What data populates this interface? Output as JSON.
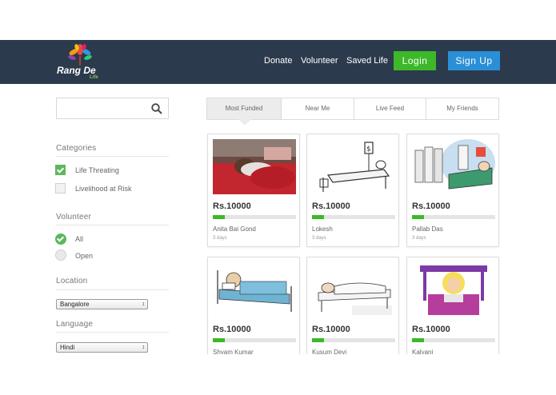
{
  "brand": {
    "name": "Rang De",
    "sub": "Life"
  },
  "nav": {
    "links": [
      "Donate",
      "Volunteer",
      "Saved Life"
    ],
    "login": "Login",
    "signup": "Sign Up"
  },
  "search": {
    "placeholder": ""
  },
  "filters": {
    "categories_title": "Categories",
    "categories": [
      {
        "label": "Life Threating",
        "checked": true
      },
      {
        "label": "Livelihood at Risk",
        "checked": false
      }
    ],
    "volunteer_title": "Volunteer",
    "volunteer": [
      {
        "label": "All",
        "selected": true
      },
      {
        "label": "Open",
        "selected": false
      }
    ],
    "location_title": "Location",
    "location_value": "Bangalore",
    "language_title": "Language",
    "language_value": "Hindi"
  },
  "tabs": [
    "Most Funded",
    "Near Me",
    "Live Feed",
    "My Friends"
  ],
  "cards": [
    {
      "amount": "Rs.10000",
      "name": "Anita Bai Gond",
      "days": "3 days",
      "progress": 0.14
    },
    {
      "amount": "Rs.10000",
      "name": "Lokesh",
      "days": "3 days",
      "progress": 0.14
    },
    {
      "amount": "Rs.10000",
      "name": "Pallab Das",
      "days": "3 days",
      "progress": 0.14
    },
    {
      "amount": "Rs.10000",
      "name": "Shyam Kumar",
      "days": "",
      "progress": 0.14
    },
    {
      "amount": "Rs.10000",
      "name": "Kusum Devi",
      "days": "",
      "progress": 0.14
    },
    {
      "amount": "Rs.10000",
      "name": "Kalyani",
      "days": "",
      "progress": 0.14
    }
  ],
  "colors": {
    "navbar": "#2c3a4d",
    "login": "#3cb829",
    "signup": "#2a8fd6",
    "check": "#5cb85c"
  }
}
